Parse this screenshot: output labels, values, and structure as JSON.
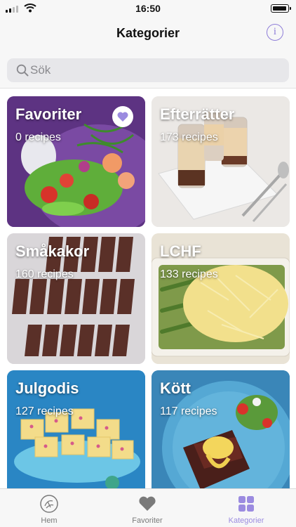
{
  "status_bar": {
    "time": "16:50"
  },
  "nav": {
    "title": "Kategorier",
    "info_icon": "info-icon"
  },
  "search": {
    "placeholder": "Sök"
  },
  "categories": [
    {
      "title": "Favoriter",
      "count": "0 recipes",
      "favorite_badge": true,
      "image": "salad-with-shrimp-and-dill"
    },
    {
      "title": "Efterrätter",
      "count": "173 recipes",
      "image": "dessert-jars-on-marble"
    },
    {
      "title": "Småkakor",
      "count": "160 recipes",
      "image": "chocolate-cookie-slices"
    },
    {
      "title": "LCHF",
      "count": "133 recipes",
      "image": "asparagus-cheese-gratin"
    },
    {
      "title": "Julgodis",
      "count": "127 recipes",
      "image": "fudge-squares-on-blue"
    },
    {
      "title": "Kött",
      "count": "117 recipes",
      "image": "steak-with-sauce-on-blue-plate"
    }
  ],
  "tab_bar": {
    "tabs": [
      {
        "label": "Hem",
        "icon": "home-logo-icon"
      },
      {
        "label": "Favoriter",
        "icon": "heart-icon"
      },
      {
        "label": "Kategorier",
        "icon": "grid-icon",
        "active": true
      }
    ]
  },
  "colors": {
    "accent": "#9b8be0",
    "inactive": "#7a7a7a",
    "bar_background": "#f7f7f7"
  }
}
